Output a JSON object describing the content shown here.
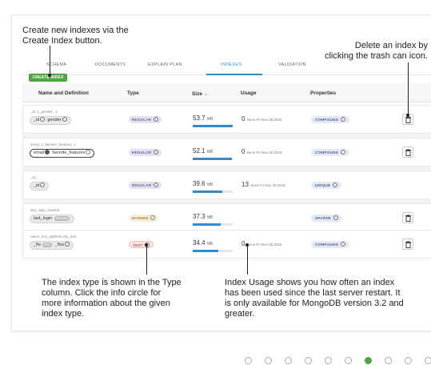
{
  "callouts": {
    "create": "Create new indexes via the Create Index button.",
    "delete": "Delete an index by clicking the trash can icon.",
    "type": "The index type is shown in the Type column. Click the info circle for more information about the given index type.",
    "usage": "Index Usage shows you how often an index has been used since the last server restart. It is only available for MongoDB version 3.2 and greater."
  },
  "tabs": [
    "SCHEMA",
    "DOCUMENTS",
    "EXPLAIN PLAN",
    "INDEXES",
    "VALIDATION"
  ],
  "active_tab": "INDEXES",
  "create_button": "CREATE INDEX",
  "columns": {
    "name": "Name and Definition",
    "type": "Type",
    "size": "Size",
    "size_sort": "⌄",
    "usage": "Usage",
    "properties": "Properties"
  },
  "indexes": [
    {
      "name": "_id_1_gender_-1",
      "fields": [
        "_id",
        "gender"
      ],
      "type": "REGULAR",
      "size_value": "53.7",
      "size_unit": "MB",
      "size_fraction": 1.0,
      "usage_count": "0",
      "usage_since": "since Fri Nov 25 2016",
      "property": "COMPOUND",
      "deletable": true
    },
    {
      "name": "email_1_favorite_features_1",
      "fields": [
        "email",
        "favorite_features"
      ],
      "type": "REGULAR",
      "size_value": "52.1",
      "size_unit": "MB",
      "size_fraction": 0.97,
      "usage_count": "0",
      "usage_since": "since Fri Nov 25 2016",
      "property": "COMPOUND",
      "deletable": true
    },
    {
      "name": "_id_",
      "fields": [
        "_id"
      ],
      "type": "REGULAR",
      "size_value": "39.6",
      "size_unit": "MB",
      "size_fraction": 0.74,
      "usage_count": "13",
      "usage_since": "since Fri Nov 25 2016",
      "property": "UNIQUE",
      "deletable": false
    },
    {
      "name": "last_login_hashed",
      "fields": [
        "last_login"
      ],
      "field_tag": "hashed",
      "type": "HASHED",
      "size_value": "37.3",
      "size_unit": "MB",
      "size_fraction": 0.69,
      "usage_count": "",
      "usage_since": "",
      "property": "SPARSE",
      "deletable": true
    },
    {
      "name": "name_text_address.city_text",
      "fields": [
        "_fts",
        "_ftsx"
      ],
      "field_tag": "text",
      "type": "TEXT",
      "size_value": "34.4",
      "size_unit": "MB",
      "size_fraction": 0.64,
      "usage_count": "0",
      "usage_since": "since Fri Nov 25 2016",
      "property": "COMPOUND",
      "deletable": true
    }
  ],
  "pager": {
    "count": 10,
    "active_index": 6
  },
  "colors": {
    "accent_blue": "#2f8bd3",
    "create_green": "#4aa63d"
  }
}
